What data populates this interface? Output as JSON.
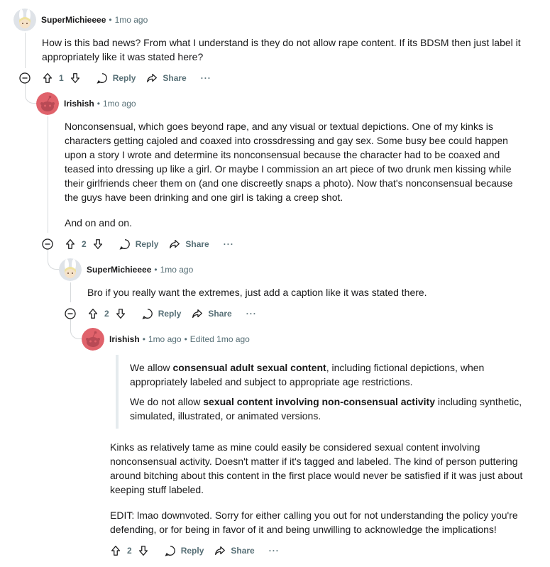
{
  "comments": [
    {
      "author": "SuperMichieeee",
      "time": "1mo ago",
      "paragraphs": [
        "How is this bad news? From what I understand is they do not allow rape content. If its BDSM then just label it appropriately like it was stated here?"
      ],
      "score": "1",
      "avatar": "bunny-avatar"
    },
    {
      "author": "Irishish",
      "time": "1mo ago",
      "paragraphs": [
        "Nonconsensual, which goes beyond rape, and any visual or textual depictions. One of my kinks is characters getting cajoled and coaxed into crossdressing and gay sex. Some busy bee could happen upon a story I wrote and determine its nonconsensual because the character had to be coaxed and teased into dressing up like a girl. Or maybe I commission an art piece of two drunk men kissing while their girlfriends cheer them on (and one discreetly snaps a photo). Now that's nonconsensual because the guys have been drinking and one girl is taking a creep shot.",
        "And on and on."
      ],
      "score": "2",
      "avatar": "snoo-avatar"
    },
    {
      "author": "SuperMichieeee",
      "time": "1mo ago",
      "paragraphs": [
        "Bro if you really want the extremes, just add a caption like it was stated there."
      ],
      "score": "2",
      "avatar": "bunny-avatar"
    },
    {
      "author": "Irishish",
      "time": "1mo ago",
      "edited": "Edited 1mo ago",
      "quote": [
        {
          "pre": "We allow ",
          "bold": "consensual adult sexual content",
          "post": ", including fictional depictions, when appropriately labeled and subject to appropriate age restrictions."
        },
        {
          "pre": "We do not allow ",
          "bold": "sexual content involving non-consensual activity",
          "post": " including synthetic, simulated, illustrated, or animated versions."
        }
      ],
      "paragraphs": [
        "Kinks as relatively tame as mine could easily be considered sexual content involving nonconsensual activity. Doesn't matter if it's tagged and labeled. The kind of person puttering around bitching about this content in the first place would never be satisfied if it was just about keeping stuff labeled.",
        "EDIT: lmao downvoted. Sorry for either calling you out for not understanding the policy you're defending, or for being in favor of it and being unwilling to acknowledge the implications!"
      ],
      "score": "2",
      "avatar": "snoo-avatar"
    }
  ],
  "actions": {
    "reply_label": "Reply",
    "share_label": "Share",
    "more_label": "···"
  },
  "separator": "•",
  "colors": {
    "text": "#1a1a1b",
    "meta": "#576f76",
    "thread": "#d7dadc",
    "snoo": "#e0626b"
  }
}
